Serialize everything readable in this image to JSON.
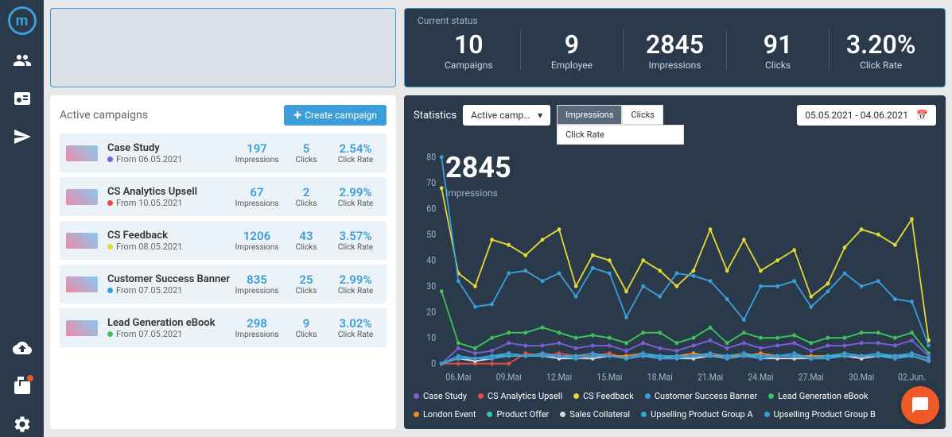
{
  "sidebar": {
    "logo_letter": "m"
  },
  "status": {
    "title": "Current status",
    "items": [
      {
        "value": "10",
        "label": "Campaigns"
      },
      {
        "value": "9",
        "label": "Employee"
      },
      {
        "value": "2845",
        "label": "Impressions"
      },
      {
        "value": "91",
        "label": "Clicks"
      },
      {
        "value": "3.20%",
        "label": "Click Rate"
      }
    ]
  },
  "campaigns": {
    "title": "Active campaigns",
    "create_label": "Create campaign",
    "metric_labels": {
      "impressions": "Impressions",
      "clicks": "Clicks",
      "rate": "Click Rate"
    },
    "items": [
      {
        "name": "Case Study",
        "date": "From 06.05.2021",
        "color": "#7a5fd8",
        "impressions": "197",
        "clicks": "5",
        "rate": "2.54%"
      },
      {
        "name": "CS Analytics Upsell",
        "date": "From 10.05.2021",
        "color": "#e74c3c",
        "impressions": "67",
        "clicks": "2",
        "rate": "2.99%"
      },
      {
        "name": "CS Feedback",
        "date": "From 08.05.2021",
        "color": "#e4d836",
        "impressions": "1206",
        "clicks": "43",
        "rate": "3.57%"
      },
      {
        "name": "Customer Success Banner",
        "date": "From 07.05.2021",
        "color": "#3b9ed8",
        "impressions": "835",
        "clicks": "25",
        "rate": "2.99%"
      },
      {
        "name": "Lead Generation eBook",
        "date": "From 07.05.2021",
        "color": "#3cc45a",
        "impressions": "298",
        "clicks": "9",
        "rate": "3.02%"
      }
    ]
  },
  "chart": {
    "section_label": "Statistics",
    "select_value": "Active camp…",
    "tabs": {
      "impressions": "Impressions",
      "clicks": "Clicks",
      "rate": "Click Rate",
      "active": "Impressions"
    },
    "date_range": "05.05.2021 - 04.06.2021",
    "big_value": "2845",
    "big_label": "Impressions",
    "legend": [
      {
        "name": "Case Study",
        "color": "#7a5fd8"
      },
      {
        "name": "CS Analytics Upsell",
        "color": "#e74c3c"
      },
      {
        "name": "CS Feedback",
        "color": "#e4d836"
      },
      {
        "name": "Customer Success Banner",
        "color": "#3b9ed8"
      },
      {
        "name": "Lead Generation eBook",
        "color": "#3cc45a"
      },
      {
        "name": "London Event",
        "color": "#f08c28"
      },
      {
        "name": "Product Offer",
        "color": "#2dc7c0"
      },
      {
        "name": "Sales Collateral",
        "color": "#d8d8d8"
      },
      {
        "name": "Upselling Product Group A",
        "color": "#3b9ed8"
      },
      {
        "name": "Upselling Product Group B",
        "color": "#3b9ed8"
      }
    ]
  },
  "chart_data": {
    "type": "line",
    "title": "Impressions",
    "xlabel": "",
    "ylabel": "",
    "ylim": [
      0,
      80
    ],
    "yticks": [
      0,
      10,
      20,
      30,
      40,
      50,
      60,
      70,
      80
    ],
    "x": [
      "05.Mai",
      "06.Mai",
      "07.Mai",
      "08.Mai",
      "09.Mai",
      "10.Mai",
      "11.Mai",
      "12.Mai",
      "13.Mai",
      "14.Mai",
      "15.Mai",
      "16.Mai",
      "17.Mai",
      "18.Mai",
      "19.Mai",
      "20.Mai",
      "21.Mai",
      "22.Mai",
      "23.Mai",
      "24.Mai",
      "25.Mai",
      "26.Mai",
      "27.Mai",
      "28.Mai",
      "29.Mai",
      "30.Mai",
      "31.Mai",
      "01.Jun",
      "02.Jun",
      "03.Jun"
    ],
    "xticks_shown": [
      "06.Mai",
      "09.Mai",
      "12.Mai",
      "15.Mai",
      "18.Mai",
      "21.Mai",
      "24.Mai",
      "27.Mai",
      "30.Mai",
      "02.Jun."
    ],
    "series": [
      {
        "name": "CS Feedback",
        "color": "#e4d836",
        "values": [
          68,
          35,
          30,
          48,
          46,
          42,
          48,
          52,
          30,
          42,
          40,
          28,
          40,
          36,
          30,
          36,
          52,
          36,
          48,
          36,
          40,
          44,
          26,
          31,
          45,
          52,
          50,
          46,
          56,
          9
        ]
      },
      {
        "name": "Customer Success Banner",
        "color": "#3b9ed8",
        "values": [
          80,
          32,
          22,
          23,
          35,
          36,
          32,
          35,
          26,
          37,
          35,
          18,
          30,
          26,
          35,
          34,
          32,
          25,
          17,
          30,
          30,
          32,
          22,
          28,
          35,
          30,
          32,
          25,
          24,
          7
        ]
      },
      {
        "name": "Lead Generation eBook",
        "color": "#3cc45a",
        "values": [
          28,
          8,
          6,
          10,
          12,
          12,
          14,
          12,
          10,
          11,
          10,
          8,
          12,
          12,
          8,
          10,
          14,
          8,
          12,
          10,
          10,
          11,
          8,
          10,
          10,
          12,
          12,
          10,
          12,
          4
        ]
      },
      {
        "name": "Case Study",
        "color": "#7a5fd8",
        "values": [
          0,
          6,
          4,
          5,
          8,
          7,
          7,
          8,
          6,
          7,
          7,
          5,
          8,
          6,
          5,
          7,
          9,
          6,
          8,
          6,
          7,
          8,
          5,
          7,
          7,
          8,
          8,
          7,
          9,
          3
        ]
      },
      {
        "name": "CS Analytics Upsell",
        "color": "#e74c3c",
        "values": [
          0,
          0,
          0,
          0,
          0,
          4,
          3,
          4,
          3,
          3,
          4,
          2,
          3,
          3,
          3,
          3,
          4,
          3,
          4,
          3,
          3,
          3,
          2,
          3,
          3,
          3,
          3,
          3,
          4,
          2
        ]
      },
      {
        "name": "London Event",
        "color": "#f08c28",
        "values": [
          0,
          2,
          2,
          3,
          4,
          3,
          4,
          3,
          3,
          4,
          3,
          3,
          4,
          3,
          3,
          4,
          3,
          3,
          3,
          4,
          3,
          3,
          3,
          3,
          4,
          3,
          3,
          3,
          4,
          2
        ]
      },
      {
        "name": "Product Offer",
        "color": "#2dc7c0",
        "values": [
          0,
          2,
          2,
          3,
          3,
          3,
          3,
          3,
          2,
          3,
          3,
          2,
          3,
          3,
          2,
          3,
          3,
          2,
          3,
          3,
          3,
          3,
          2,
          3,
          3,
          3,
          3,
          3,
          3,
          1
        ]
      },
      {
        "name": "Sales Collateral",
        "color": "#d8d8d8",
        "values": [
          0,
          2,
          1,
          2,
          3,
          3,
          3,
          2,
          2,
          2,
          3,
          2,
          3,
          2,
          2,
          2,
          3,
          2,
          3,
          2,
          2,
          2,
          2,
          2,
          3,
          2,
          3,
          2,
          3,
          1
        ]
      },
      {
        "name": "Upselling Product Group A",
        "color": "#3b9ed8",
        "values": [
          0,
          3,
          2,
          3,
          4,
          3,
          4,
          3,
          3,
          4,
          3,
          2,
          4,
          3,
          3,
          3,
          4,
          3,
          4,
          3,
          3,
          4,
          2,
          3,
          4,
          3,
          4,
          3,
          4,
          2
        ]
      },
      {
        "name": "Upselling Product Group B",
        "color": "#3b9ed8",
        "values": [
          0,
          2,
          2,
          2,
          3,
          3,
          3,
          3,
          2,
          3,
          3,
          2,
          3,
          2,
          2,
          3,
          3,
          2,
          3,
          2,
          3,
          3,
          2,
          2,
          3,
          3,
          3,
          2,
          3,
          1
        ]
      }
    ]
  }
}
